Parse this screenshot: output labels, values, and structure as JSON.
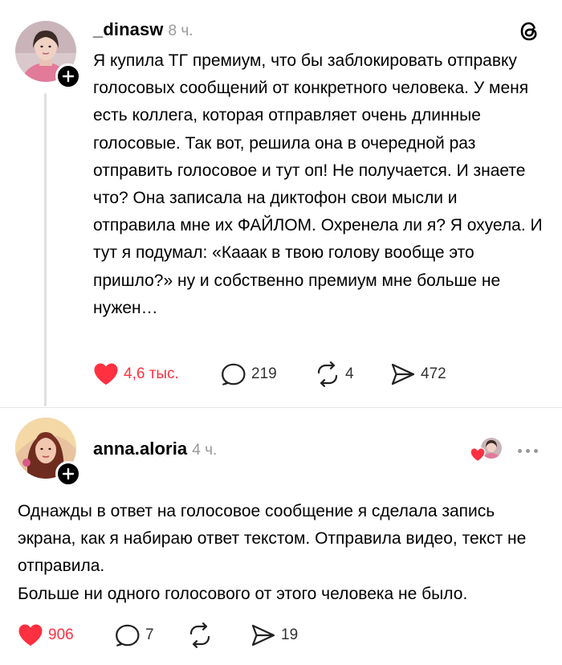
{
  "posts": [
    {
      "username": "_dinasw",
      "time": "8 ч.",
      "text": "Я купила ТГ премиум, что бы заблокировать отправку голосовых сообщений от конкретного человека. У меня есть коллега, которая отправляет очень длинные голосовые. Так вот, решила она в очередной раз отправить голосовое и тут оп! Не получается. И знаете что? Она записала на диктофон свои мысли и отправила мне их ФАЙЛОМ. Охренела ли я? Я охуела. И тут я подумал: «Кааак в твою голову вообще это пришло?» ну и собственно премиум мне больше не нужен…",
      "likes": "4,6 тыс.",
      "replies": "219",
      "reposts": "4",
      "shares": "472"
    },
    {
      "username": "anna.aloria",
      "time": "4 ч.",
      "paragraph1": "Однажды в ответ на голосовое сообщение я сделала запись экрана, как я набираю ответ текстом. Отправила видео, текст не отправила.",
      "paragraph2": "Больше ни одного голосового от этого человека не было.",
      "likes": "906",
      "replies": "7",
      "reposts": "",
      "shares": "19"
    }
  ],
  "colors": {
    "like": "#ff3040",
    "muted": "#999999",
    "line": "#e0e0e0"
  },
  "icons": [
    "threads-logo-icon",
    "plus-icon",
    "heart-icon",
    "reply-icon",
    "repost-icon",
    "share-icon",
    "more-icon"
  ]
}
